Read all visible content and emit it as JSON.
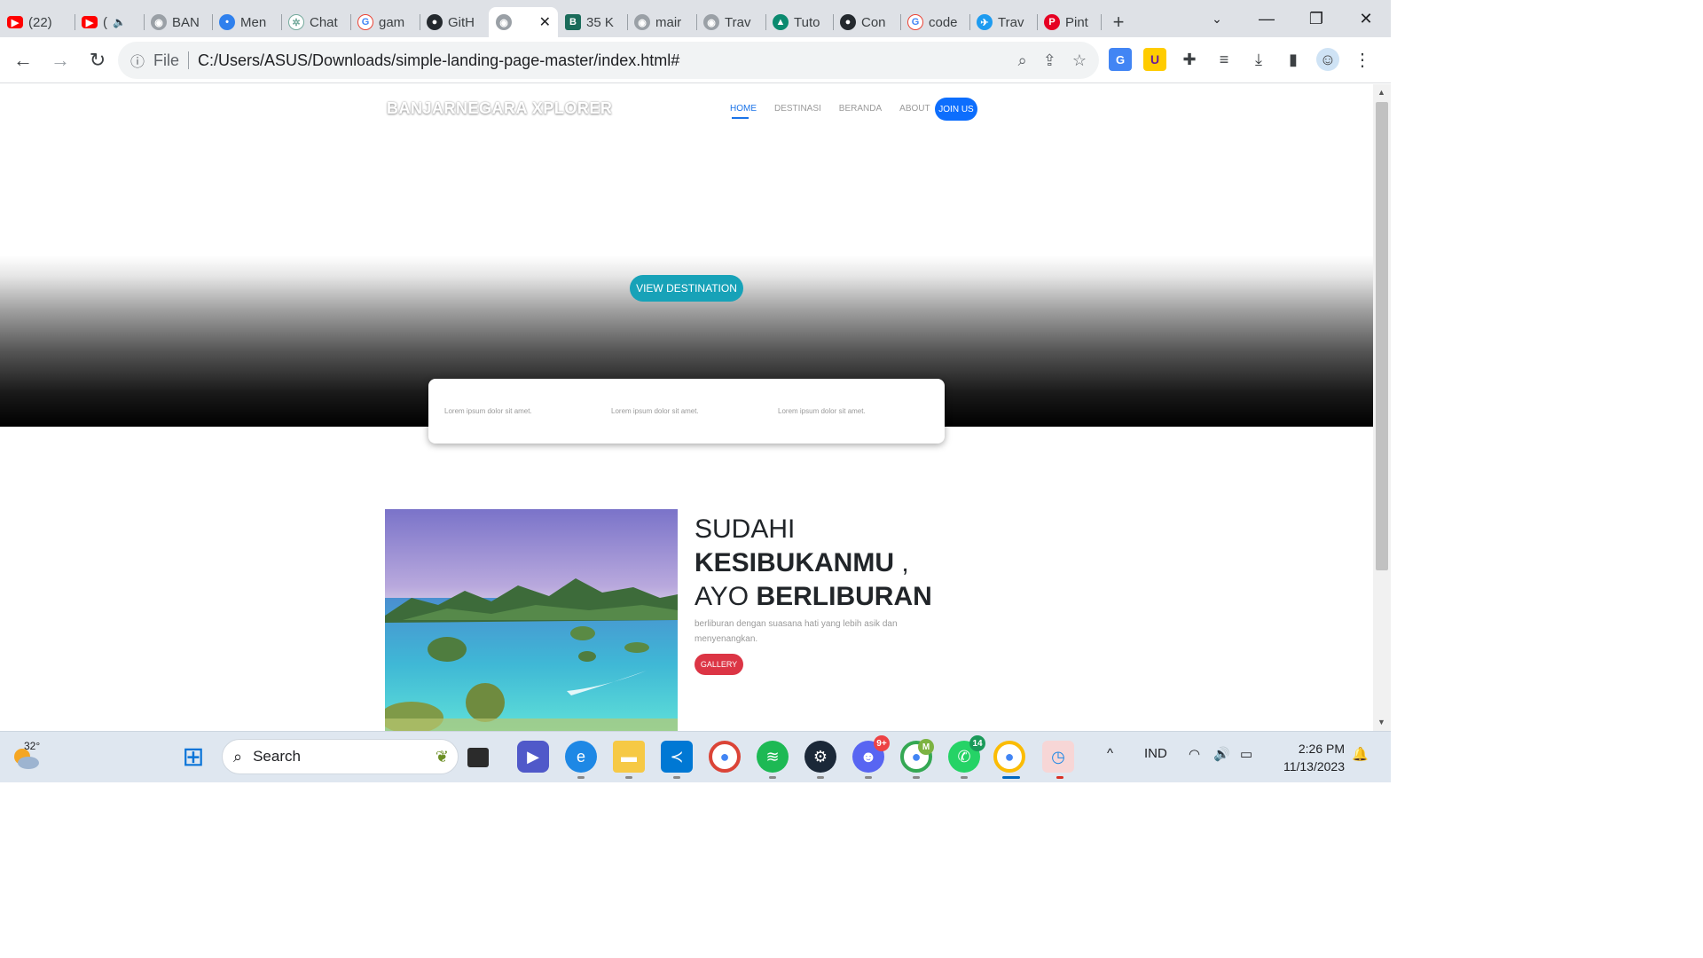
{
  "browser": {
    "tabs": [
      {
        "label": "(22)",
        "favicon": "youtube-icon",
        "color": "#ff0000"
      },
      {
        "label": "(",
        "favicon": "youtube-icon",
        "color": "#ff0000",
        "muted": "🔈"
      },
      {
        "label": "BAN",
        "favicon": "globe-icon",
        "color": "#5f6368"
      },
      {
        "label": "Men",
        "favicon": "site-icon",
        "color": "#2f80ed"
      },
      {
        "label": "Chat",
        "favicon": "chatgpt-icon",
        "color": "#74aa9c"
      },
      {
        "label": "gam",
        "favicon": "google-icon",
        "color": "#4285f4"
      },
      {
        "label": "GitH",
        "favicon": "github-icon",
        "color": "#24292e"
      },
      {
        "label": "",
        "favicon": "globe-icon",
        "color": "#5f6368",
        "active": true
      },
      {
        "label": "35 K",
        "favicon": "bootstrap-icon",
        "color": "#1a6b5a"
      },
      {
        "label": "mair",
        "favicon": "globe-icon",
        "color": "#5f6368"
      },
      {
        "label": "Trav",
        "favicon": "globe-icon",
        "color": "#5f6368"
      },
      {
        "label": "Tuto",
        "favicon": "tutorial-icon",
        "color": "#0b8a6f"
      },
      {
        "label": "Con",
        "favicon": "github-icon",
        "color": "#24292e"
      },
      {
        "label": "code",
        "favicon": "google-icon",
        "color": "#4285f4"
      },
      {
        "label": "Trav",
        "favicon": "bird-icon",
        "color": "#1d9bf0"
      },
      {
        "label": "Pint",
        "favicon": "pinterest-icon",
        "color": "#e60023"
      }
    ],
    "new_tab": "+",
    "close_tab": "✕",
    "window_controls": {
      "search_tabs": "⌄",
      "minimize": "—",
      "restore": "❐",
      "close": "✕"
    },
    "toolbar": {
      "back": "←",
      "forward": "→",
      "reload": "↻"
    },
    "omnibox": {
      "info": "ⓘ",
      "scheme": "File",
      "url": "C:/Users/ASUS/Downloads/simple-landing-page-master/index.html#"
    },
    "omni_actions": {
      "zoom": "⌕",
      "share": "⇪",
      "bookmark": "☆"
    },
    "extensions": [
      "G",
      "U",
      "✚",
      "≡",
      "⤓",
      "▮",
      "☺",
      "⋮"
    ]
  },
  "page": {
    "brand": "BANJARNEGARA XPLORER",
    "menu": [
      "HOME",
      "DESTINASI",
      "BERANDA",
      "ABOUT"
    ],
    "join_label": "JOIN US",
    "view_destination_label": "VIEW DESTINATION",
    "info_items": [
      "Lorem ipsum dolor sit amet.",
      "Lorem ipsum dolor sit amet.",
      "Lorem ipsum dolor sit amet."
    ],
    "headline": {
      "line1": "SUDAHI",
      "line2_bold": "KESIBUKANMU",
      "line2_rest": " ,",
      "line3_light": "AYO ",
      "line3_bold": "BERLIBURAN"
    },
    "subtext": "berliburan dengan suasana hati yang lebih asik dan menyenangkan.",
    "gallery_label": "GALLERY"
  },
  "taskbar": {
    "weather_temp": "32°",
    "search_label": "Search",
    "discord_badge": "9+",
    "whatsapp_badge": "14",
    "chrome_badge": "M",
    "language": "IND",
    "time": "2:26 PM",
    "date": "11/13/2023",
    "tray_up": "^",
    "wifi": "◠",
    "volume": "🔊",
    "battery": "▭",
    "notification": "🔔"
  }
}
